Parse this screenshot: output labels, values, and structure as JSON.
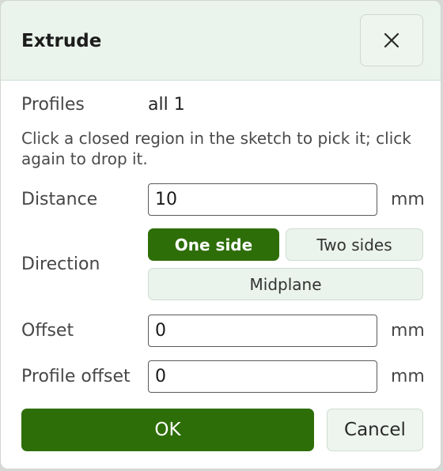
{
  "dialog": {
    "title": "Extrude",
    "close_icon": "close-icon"
  },
  "profiles": {
    "label": "Profiles",
    "value": "all 1"
  },
  "hint": "Click a closed region in the sketch to pick it; click again to drop it.",
  "distance": {
    "label": "Distance",
    "value": "10",
    "unit": "mm"
  },
  "direction": {
    "label": "Direction",
    "options": [
      "One side",
      "Two sides",
      "Midplane"
    ],
    "selected": "One side"
  },
  "offset": {
    "label": "Offset",
    "value": "0",
    "unit": "mm"
  },
  "profile_offset": {
    "label": "Profile offset",
    "value": "0",
    "unit": "mm"
  },
  "actions": {
    "ok_label": "OK",
    "cancel_label": "Cancel"
  },
  "colors": {
    "accent": "#2e6e08",
    "header_bg": "#eaf3ec",
    "secondary_bg": "#eef5ef"
  }
}
